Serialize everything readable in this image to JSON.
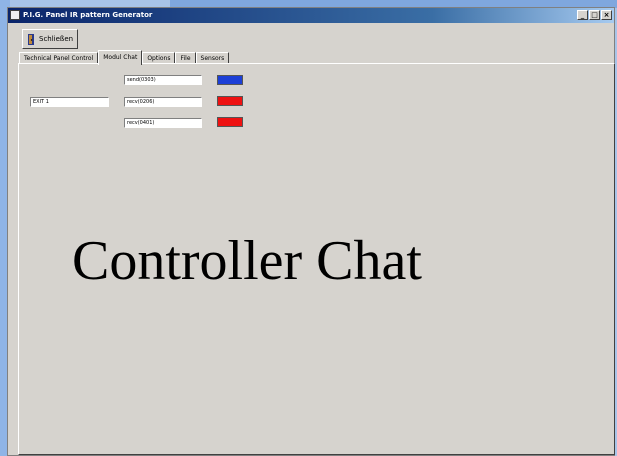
{
  "window": {
    "title": "P.I.G. Panel IR pattern Generator",
    "controls": [
      "_",
      "□",
      "×"
    ]
  },
  "toolbar": {
    "quit_label": "Schließen"
  },
  "tabs": [
    {
      "label": "Technical Panel Control",
      "active": false
    },
    {
      "label": "Modul Chat",
      "active": true
    },
    {
      "label": "Options",
      "active": false
    },
    {
      "label": "File",
      "active": false
    },
    {
      "label": "Sensors",
      "active": false
    }
  ],
  "chat": {
    "message_field": "EXIT 1",
    "rows": [
      {
        "value": "send(0303)",
        "color": "#1c3fd6"
      },
      {
        "value": "recv(0206)",
        "color": "#ee1111"
      },
      {
        "value": "recv(0401)",
        "color": "#ee1111"
      }
    ]
  },
  "overlay": {
    "caption": "Controller Chat"
  }
}
